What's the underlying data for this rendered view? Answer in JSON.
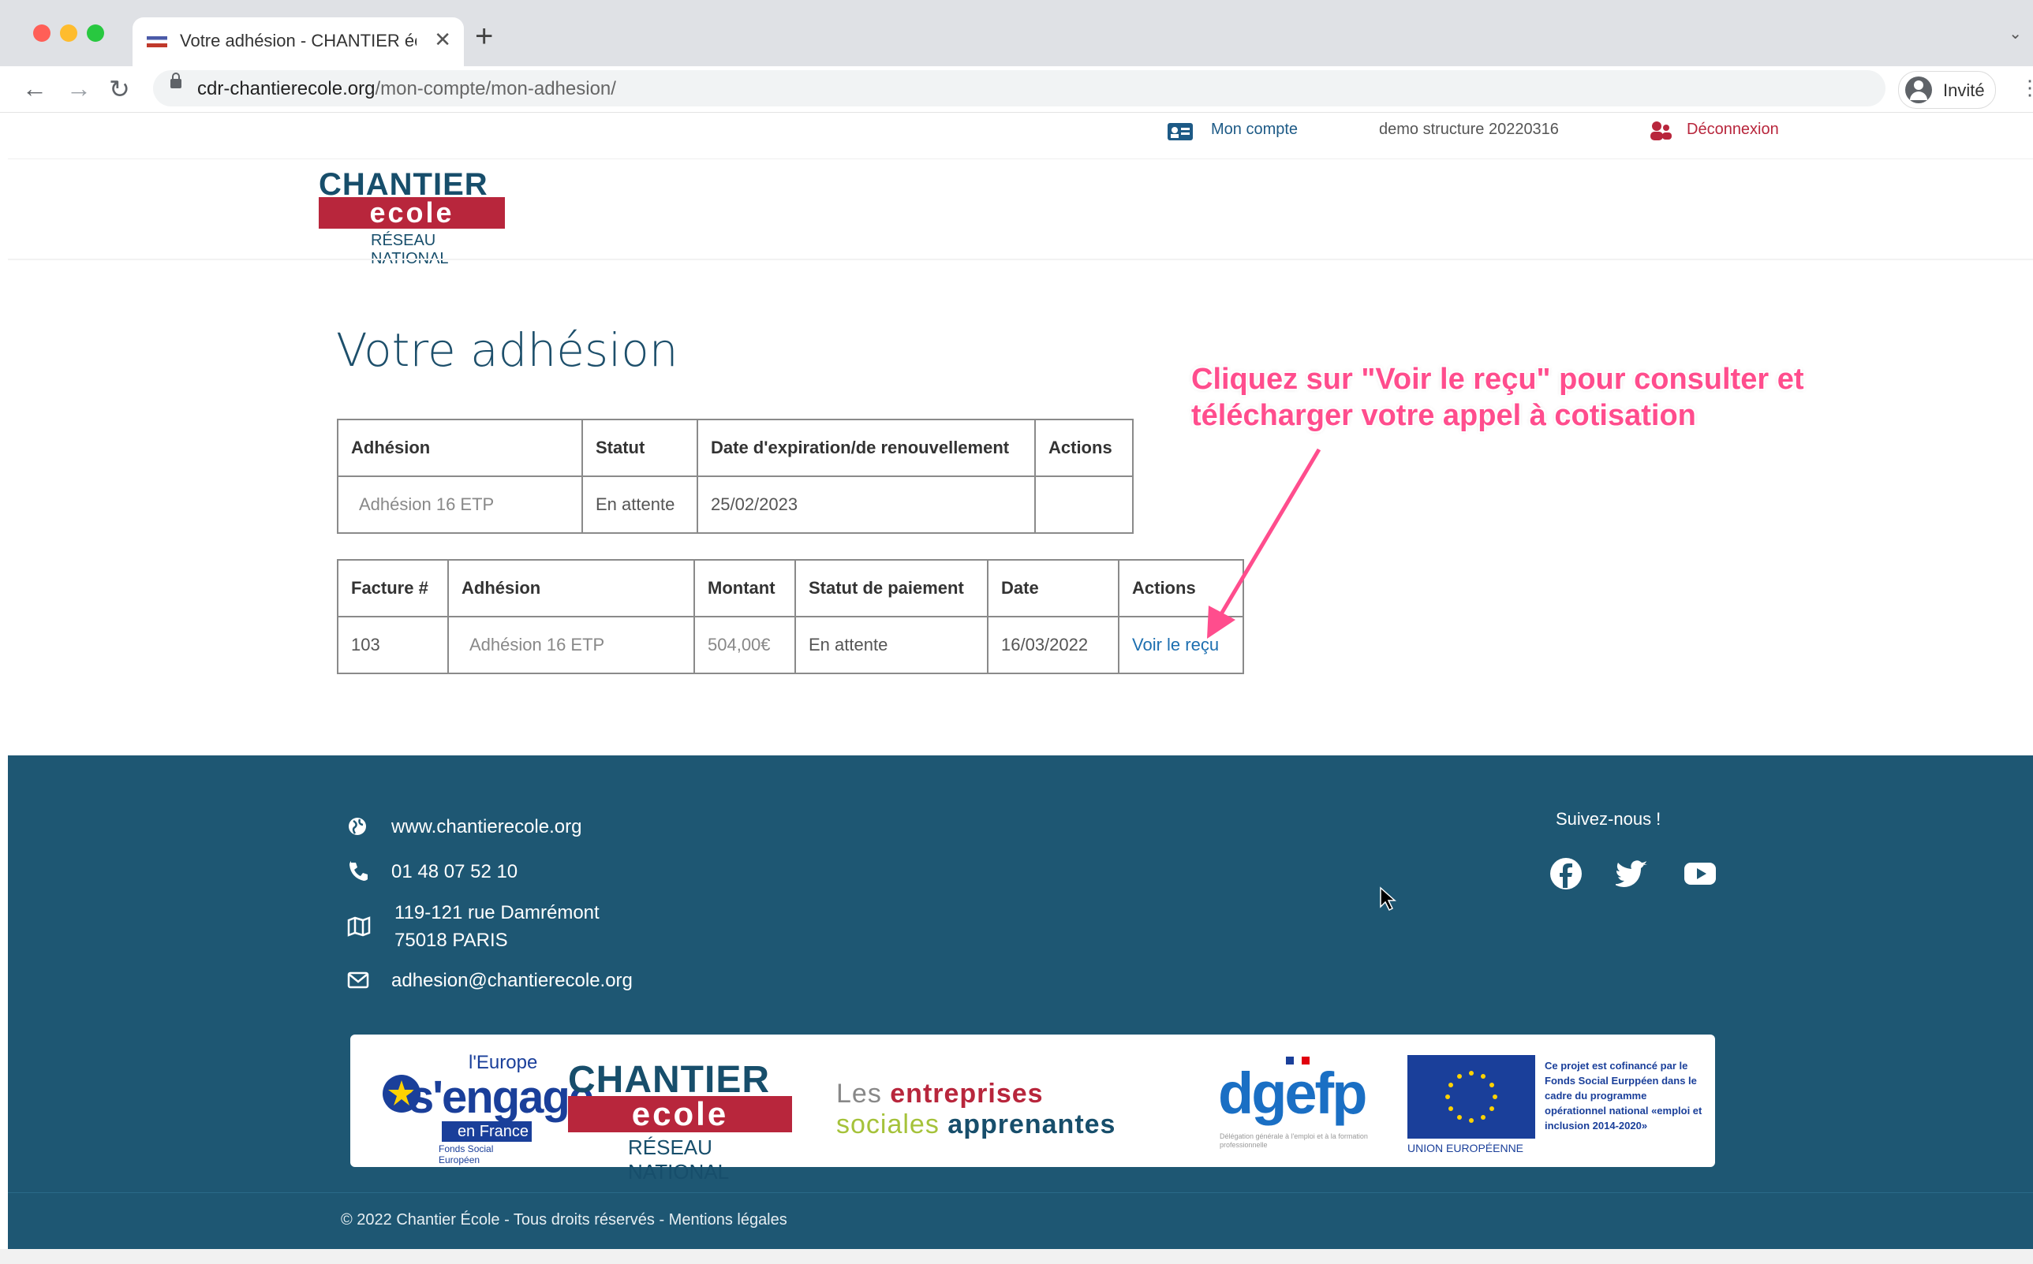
{
  "browser": {
    "tab_title": "Votre adhésion - CHANTIER éc",
    "url_host": "cdr-chantierecole.org",
    "url_path": "/mon-compte/mon-adhesion/",
    "profile_label": "Invité"
  },
  "site_header": {
    "account_link": "Mon compte",
    "structure_name": "demo structure 20220316",
    "logout_link": "Déconnexion"
  },
  "logo": {
    "line1": "CHANTIER",
    "line2": "ecole",
    "line3": "RÉSEAU NATIONAL"
  },
  "page_title": "Votre adhésion",
  "membership_table": {
    "headers": [
      "Adhésion",
      "Statut",
      "Date d'expiration/de renouvellement",
      "Actions"
    ],
    "rows": [
      [
        "Adhésion 16 ETP",
        "En attente",
        "25/02/2023",
        ""
      ]
    ]
  },
  "invoice_table": {
    "headers": [
      "Facture #",
      "Adhésion",
      "Montant",
      "Statut de paiement",
      "Date",
      "Actions"
    ],
    "rows": [
      [
        "103",
        "Adhésion 16 ETP",
        "504,00€",
        "En attente",
        "16/03/2022",
        "Voir le reçu"
      ]
    ]
  },
  "annotation": {
    "line1": "Cliquez sur \"Voir le reçu\" pour consulter et",
    "line2": "télécharger votre appel à cotisation",
    "color": "#ff4d8d"
  },
  "footer": {
    "website": "www.chantierecole.org",
    "phone": "01 48 07 52 10",
    "address_line1": "119-121 rue Damrémont",
    "address_line2": "75018 PARIS",
    "email": "adhesion@chantierecole.org",
    "follow_label": "Suivez-nous !",
    "social_icons": [
      "facebook-icon",
      "twitter-icon",
      "youtube-icon"
    ],
    "copyright": "© 2022 Chantier École - Tous droits réservés - Mentions légales",
    "bg_color": "#1e5773"
  },
  "partners": {
    "europe_line1": "l'Europe",
    "europe_line2": "s'engage",
    "europe_line3": "en France",
    "europe_line4": "Fonds Social Européen",
    "chantier_line1": "CHANTIER",
    "chantier_line2": "ecole",
    "chantier_line3": "RÉSEAU NATIONAL",
    "esa_line1a": "Les ",
    "esa_line1b": "entreprises",
    "esa_line2a": "sociales ",
    "esa_line2b": "apprenantes",
    "dgefp": "dgefp",
    "dgefp_sub": "Délégation générale à l'emploi et à la formation professionnelle",
    "eu_label": "UNION EUROPÉENNE",
    "eu_text": "Ce projet est cofinancé par le Fonds Social Eurppéen dans le cadre du programme opérationnel national «emploi et inclusion 2014-2020»"
  }
}
